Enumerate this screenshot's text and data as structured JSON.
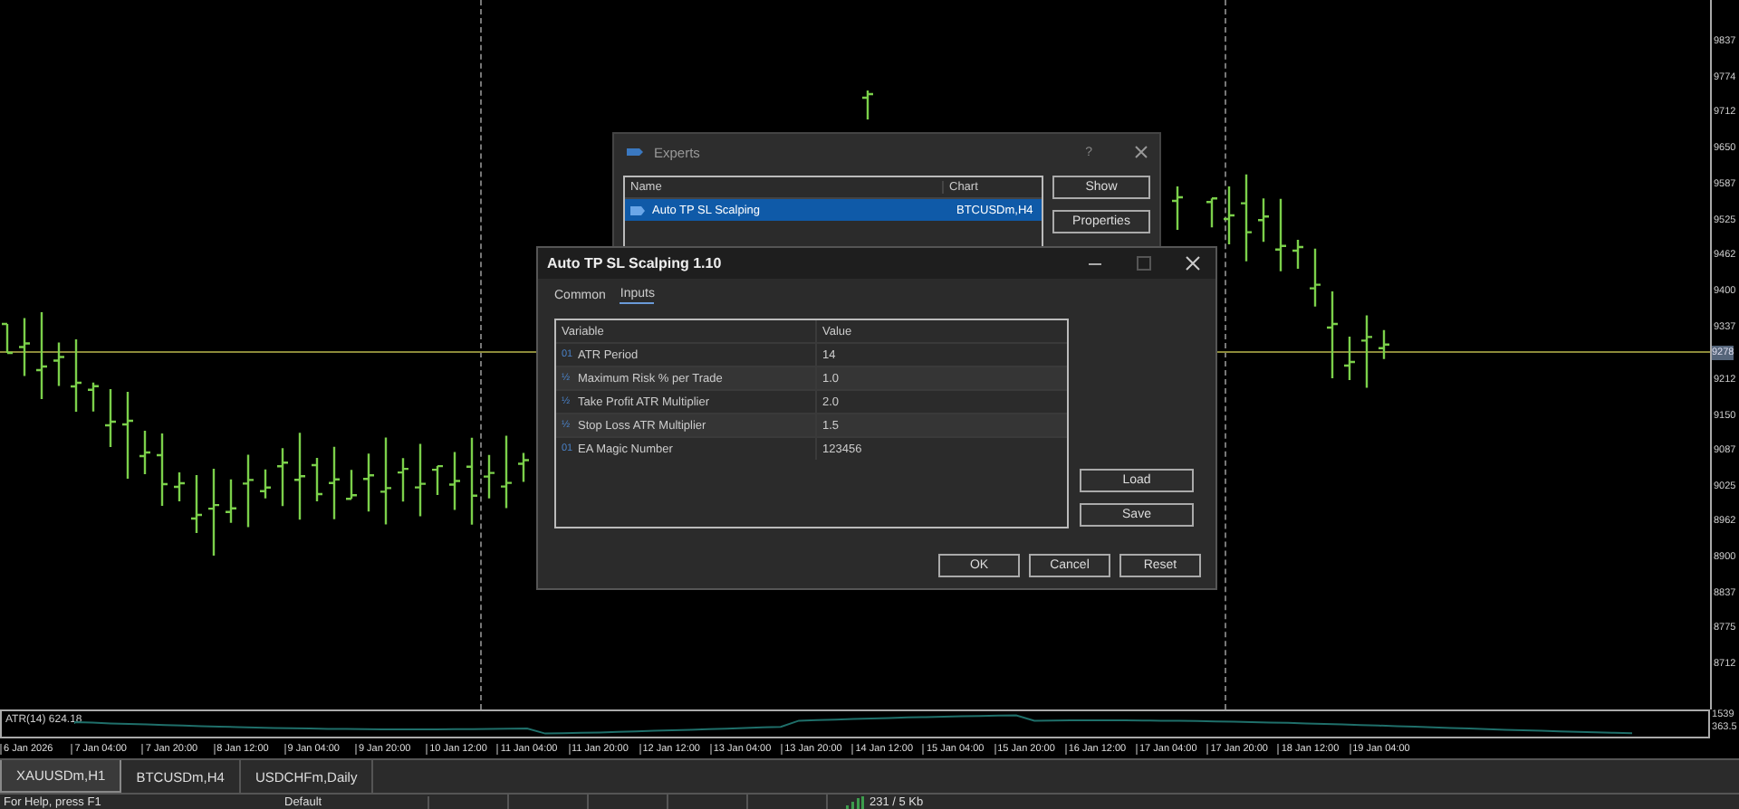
{
  "chart": {
    "price_axis": {
      "labels": [
        "9837",
        "9774",
        "9712",
        "9650",
        "9587",
        "9525",
        "9462",
        "9400",
        "9337",
        "9212",
        "9150",
        "9087",
        "9025",
        "8962",
        "8900",
        "8837",
        "8775",
        "8712"
      ],
      "current": "9278"
    },
    "indicator": {
      "label": "ATR(14) 624.18",
      "axis": [
        "1539",
        "363.5"
      ]
    },
    "time_axis": [
      "6 Jan 2026",
      "7 Jan 04:00",
      "7 Jan 20:00",
      "8 Jan 12:00",
      "9 Jan 04:00",
      "9 Jan 20:00",
      "10 Jan 12:00",
      "11 Jan 04:00",
      "11 Jan 20:00",
      "12 Jan 12:00",
      "13 Jan 04:00",
      "13 Jan 20:00",
      "14 Jan 12:00",
      "15 Jan 04:00",
      "15 Jan 20:00",
      "16 Jan 12:00",
      "17 Jan 04:00",
      "17 Jan 20:00",
      "18 Jan 12:00",
      "19 Jan 04:00"
    ],
    "symbol_tabs": [
      {
        "label": "XAUUSDm,H1",
        "selected": true
      },
      {
        "label": "BTCUSDm,H4",
        "selected": false
      },
      {
        "label": "USDCHFm,Daily",
        "selected": false
      }
    ]
  },
  "experts_dialog": {
    "title": "Experts",
    "help": "?",
    "columns": [
      "Name",
      "Chart"
    ],
    "rows": [
      {
        "name": "Auto TP SL Scalping",
        "chart": "BTCUSDm,H4",
        "selected": true
      }
    ],
    "buttons": [
      "Show",
      "Properties"
    ]
  },
  "inputs_dialog": {
    "title": "Auto TP SL Scalping 1.10",
    "tabs": [
      {
        "label": "Common",
        "selected": false
      },
      {
        "label": "Inputs",
        "selected": true
      }
    ],
    "columns": [
      "Variable",
      "Value"
    ],
    "params": [
      {
        "type_icon": "01",
        "variable": "ATR Period",
        "value": "14"
      },
      {
        "type_icon": "½",
        "variable": "Maximum Risk % per Trade",
        "value": "1.0"
      },
      {
        "type_icon": "½",
        "variable": "Take Profit ATR Multiplier",
        "value": "2.0"
      },
      {
        "type_icon": "½",
        "variable": "Stop Loss ATR Multiplier",
        "value": "1.5"
      },
      {
        "type_icon": "01",
        "variable": "EA Magic Number",
        "value": "123456"
      }
    ],
    "side_buttons": [
      "Load",
      "Save"
    ],
    "buttons": [
      "OK",
      "Cancel",
      "Reset"
    ]
  },
  "status_bar": {
    "help": "For Help, press F1",
    "profile": "Default",
    "traffic": "231 / 5 Kb"
  }
}
